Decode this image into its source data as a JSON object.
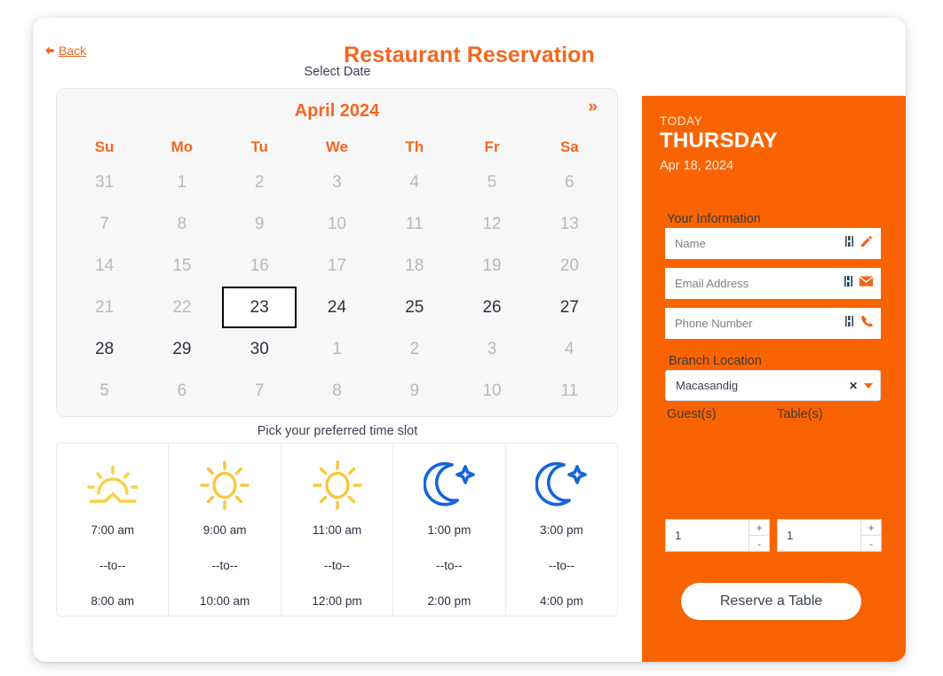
{
  "header": {
    "back_label": "Back",
    "back_icon": "arrow-left-icon",
    "title": "Restaurant Reservation"
  },
  "left": {
    "select_date_label": "Select Date",
    "timeslot_label": "Pick your preferred time slot"
  },
  "calendar": {
    "month_label": "April 2024",
    "next_label": "»",
    "dow": [
      "Su",
      "Mo",
      "Tu",
      "We",
      "Th",
      "Fr",
      "Sa"
    ],
    "selected_day": "23",
    "days": [
      {
        "n": "31",
        "muted": true
      },
      {
        "n": "1",
        "muted": true
      },
      {
        "n": "2",
        "muted": true
      },
      {
        "n": "3",
        "muted": true
      },
      {
        "n": "4",
        "muted": true
      },
      {
        "n": "5",
        "muted": true
      },
      {
        "n": "6",
        "muted": true
      },
      {
        "n": "7",
        "muted": true
      },
      {
        "n": "8",
        "muted": true
      },
      {
        "n": "9",
        "muted": true
      },
      {
        "n": "10",
        "muted": true
      },
      {
        "n": "11",
        "muted": true
      },
      {
        "n": "12",
        "muted": true
      },
      {
        "n": "13",
        "muted": true
      },
      {
        "n": "14",
        "muted": true
      },
      {
        "n": "15",
        "muted": true
      },
      {
        "n": "16",
        "muted": true
      },
      {
        "n": "17",
        "muted": true
      },
      {
        "n": "18",
        "muted": true
      },
      {
        "n": "19",
        "muted": true
      },
      {
        "n": "20",
        "muted": true
      },
      {
        "n": "21",
        "muted": true
      },
      {
        "n": "22",
        "muted": true
      },
      {
        "n": "23",
        "muted": false,
        "selected": true
      },
      {
        "n": "24",
        "muted": false
      },
      {
        "n": "25",
        "muted": false
      },
      {
        "n": "26",
        "muted": false
      },
      {
        "n": "27",
        "muted": false
      },
      {
        "n": "28",
        "muted": false
      },
      {
        "n": "29",
        "muted": false
      },
      {
        "n": "30",
        "muted": false
      },
      {
        "n": "1",
        "muted": true
      },
      {
        "n": "2",
        "muted": true
      },
      {
        "n": "3",
        "muted": true
      },
      {
        "n": "4",
        "muted": true
      },
      {
        "n": "5",
        "muted": true
      },
      {
        "n": "6",
        "muted": true
      },
      {
        "n": "7",
        "muted": true
      },
      {
        "n": "8",
        "muted": true
      },
      {
        "n": "9",
        "muted": true
      },
      {
        "n": "10",
        "muted": true
      },
      {
        "n": "11",
        "muted": true
      }
    ]
  },
  "time_slots": {
    "separator": "--to--",
    "items": [
      {
        "icon": "sunrise-icon",
        "start": "7:00 am",
        "end": "8:00 am",
        "color": "#f7d145"
      },
      {
        "icon": "sun-icon",
        "start": "9:00 am",
        "end": "10:00 am",
        "color": "#f7c73f"
      },
      {
        "icon": "sun-icon",
        "start": "11:00 am",
        "end": "12:00 pm",
        "color": "#f7c73f"
      },
      {
        "icon": "moon-star-icon",
        "start": "1:00 pm",
        "end": "2:00 pm",
        "color": "#1565d8"
      },
      {
        "icon": "moon-star-icon",
        "start": "3:00 pm",
        "end": "4:00 pm",
        "color": "#1565d8"
      }
    ]
  },
  "right": {
    "today_label": "TODAY",
    "weekday": "THURSDAY",
    "date": "Apr 18, 2024",
    "your_information_label": "Your Information",
    "fields": [
      {
        "placeholder": "Name",
        "icon": "pencil-icon"
      },
      {
        "placeholder": "Email Address",
        "icon": "envelope-icon"
      },
      {
        "placeholder": "Phone Number",
        "icon": "phone-icon"
      }
    ],
    "branch_label": "Branch Location",
    "branch_value": "Macasandig",
    "branch_clear_icon": "close-x-icon",
    "branch_caret_icon": "chevron-down-icon",
    "guests_label": "Guest(s)",
    "guests_value": "1",
    "tables_label": "Table(s)",
    "tables_value": "1",
    "stepper_up": "+",
    "stepper_down": "-",
    "reserve_label": "Reserve a Table"
  },
  "colors": {
    "brand_orange": "#fa6400",
    "title_orange": "#f4661f",
    "panel_bg": "#f7f7f8",
    "text_dark": "#2c3141",
    "muted": "#b7b9be",
    "sun_yellow": "#f7c73f",
    "moon_blue": "#1565d8"
  }
}
